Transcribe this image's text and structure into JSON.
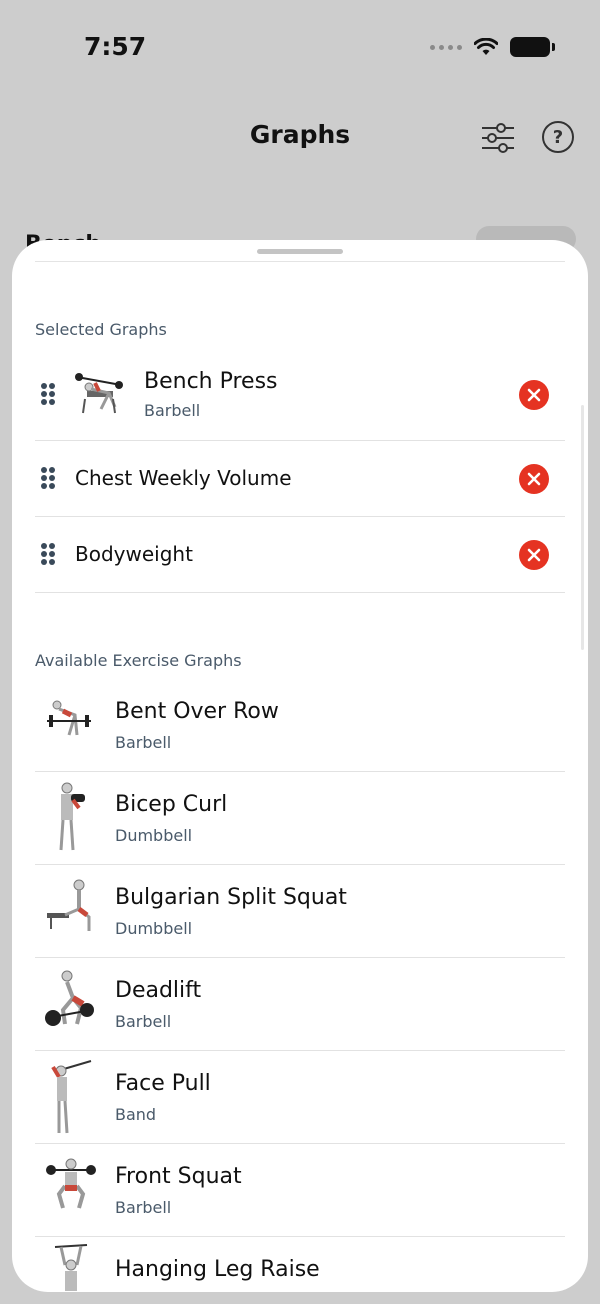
{
  "status_bar": {
    "time": "7:57"
  },
  "nav": {
    "title": "Graphs",
    "help_label": "?"
  },
  "background_peek": {
    "text": "Bench"
  },
  "sections": {
    "selected_label": "Selected Graphs",
    "available_label": "Available Exercise Graphs"
  },
  "selected": [
    {
      "title": "Bench Press",
      "subtitle": "Barbell",
      "icon": "bench-press-figure"
    },
    {
      "title": "Chest Weekly Volume",
      "icon": "none"
    },
    {
      "title": "Bodyweight",
      "icon": "none"
    }
  ],
  "available": [
    {
      "title": "Bent Over Row",
      "subtitle": "Barbell",
      "icon": "bent-over-row-figure"
    },
    {
      "title": "Bicep Curl",
      "subtitle": "Dumbbell",
      "icon": "bicep-curl-figure"
    },
    {
      "title": "Bulgarian Split Squat",
      "subtitle": "Dumbbell",
      "icon": "split-squat-figure"
    },
    {
      "title": "Deadlift",
      "subtitle": "Barbell",
      "icon": "deadlift-figure"
    },
    {
      "title": "Face Pull",
      "subtitle": "Band",
      "icon": "face-pull-figure"
    },
    {
      "title": "Front Squat",
      "subtitle": "Barbell",
      "icon": "front-squat-figure"
    },
    {
      "title": "Hanging Leg Raise",
      "icon": "hanging-leg-raise-figure"
    }
  ],
  "colors": {
    "accent_remove": "#e53322",
    "secondary_text": "#4a5a6a",
    "muscle_highlight": "#c8483a"
  }
}
